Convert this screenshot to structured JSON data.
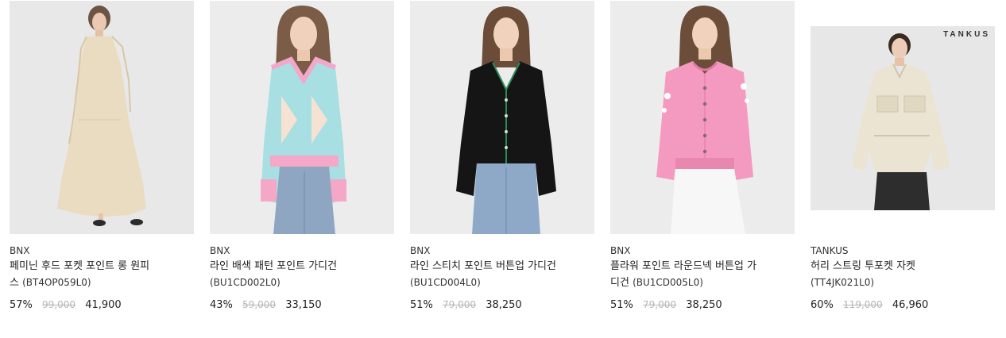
{
  "products": [
    {
      "brand": "BNX",
      "name": "페미닌 후드 포켓 포인트 롱 원피스",
      "name_line1": "페미닌 후드 포켓 포인트 롱 원피",
      "name_line2": "스",
      "code": "(BT4OP059L0)",
      "discount": "57%",
      "original_price": "99,000",
      "sale_price": "41,900",
      "image_icon": "woman-long-beige-dress-photo"
    },
    {
      "brand": "BNX",
      "name": "라인 배색 패턴 포인트 가디건",
      "name_line1": "라인 배색 패턴 포인트 가디건",
      "name_line2": "",
      "code": "(BU1CD002L0)",
      "discount": "43%",
      "original_price": "59,000",
      "sale_price": "33,150",
      "image_icon": "woman-pastel-argyle-cardigan-photo"
    },
    {
      "brand": "BNX",
      "name": "라인 스티치 포인트 버튼업 가디건",
      "name_line1": "라인 스티치 포인트 버튼업 가디건",
      "name_line2": "",
      "code": "(BU1CD004L0)",
      "discount": "51%",
      "original_price": "79,000",
      "sale_price": "38,250",
      "image_icon": "woman-black-cardigan-photo"
    },
    {
      "brand": "BNX",
      "name": "플라워 포인트 라운드넥 버튼업 가디건",
      "name_line1": "플라워 포인트 라운드넥 버튼업 가",
      "name_line2": "디건",
      "code": "(BU1CD005L0)",
      "discount": "51%",
      "original_price": "79,000",
      "sale_price": "38,250",
      "image_icon": "woman-pink-cardigan-photo"
    },
    {
      "brand": "TANKUS",
      "name": "허리 스트링 투포켓 자켓",
      "name_line1": "허리 스트링 투포켓 자켓",
      "name_line2": "",
      "code": "(TT4JK021L0)",
      "discount": "60%",
      "original_price": "119,000",
      "sale_price": "46,960",
      "image_icon": "woman-beige-jacket-photo",
      "watermark": "TANKUS"
    }
  ],
  "colors": {
    "text": "#222222",
    "strike": "#b5b5b5",
    "photo_bg": "#e9e9ea"
  }
}
